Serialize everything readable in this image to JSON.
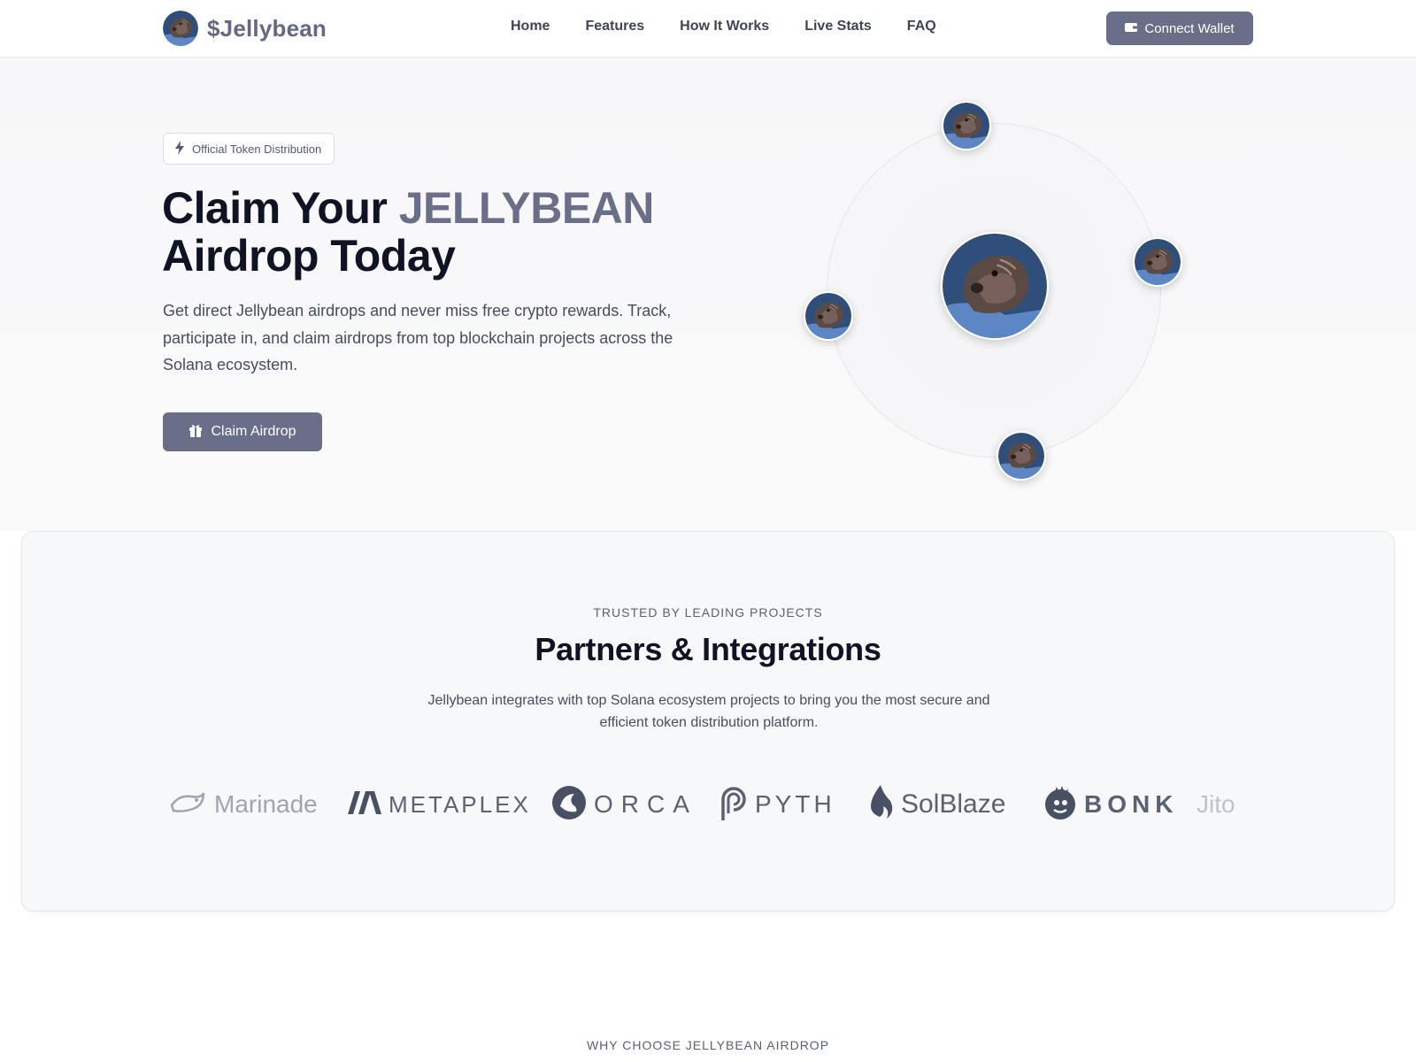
{
  "nav": {
    "brand": "$Jellybean",
    "links": [
      "Home",
      "Features",
      "How It Works",
      "Live Stats",
      "FAQ"
    ],
    "connect_label": "Connect Wallet"
  },
  "hero": {
    "badge": "Official Token Distribution",
    "headline_prefix": "Claim Your ",
    "headline_accent": "JELLYBEAN",
    "headline_line2": "Airdrop Today",
    "description": "Get direct Jellybean airdrops and never miss free crypto rewards. Track, participate in, and claim airdrops from top blockchain projects across the Solana ecosystem.",
    "cta_label": "Claim Airdrop"
  },
  "partners": {
    "eyebrow": "TRUSTED BY LEADING PROJECTS",
    "title": "Partners & Integrations",
    "description": "Jellybean integrates with top Solana ecosystem projects to bring you the most secure and efficient token distribution platform.",
    "logos": [
      "Marinade",
      "METAPLEX",
      "ORCA",
      "PYTH",
      "SolBlaze",
      "BONK",
      "Jito"
    ]
  },
  "why": {
    "eyebrow": "WHY CHOOSE JELLYBEAN AIRDROP"
  },
  "colors": {
    "accent": "#6b6e88",
    "heading": "#0f1324",
    "body": "#474d5f",
    "muted": "#5b6173"
  },
  "icons": {
    "badge": "lightning-icon",
    "connect": "wallet-icon",
    "cta": "gift-icon"
  }
}
